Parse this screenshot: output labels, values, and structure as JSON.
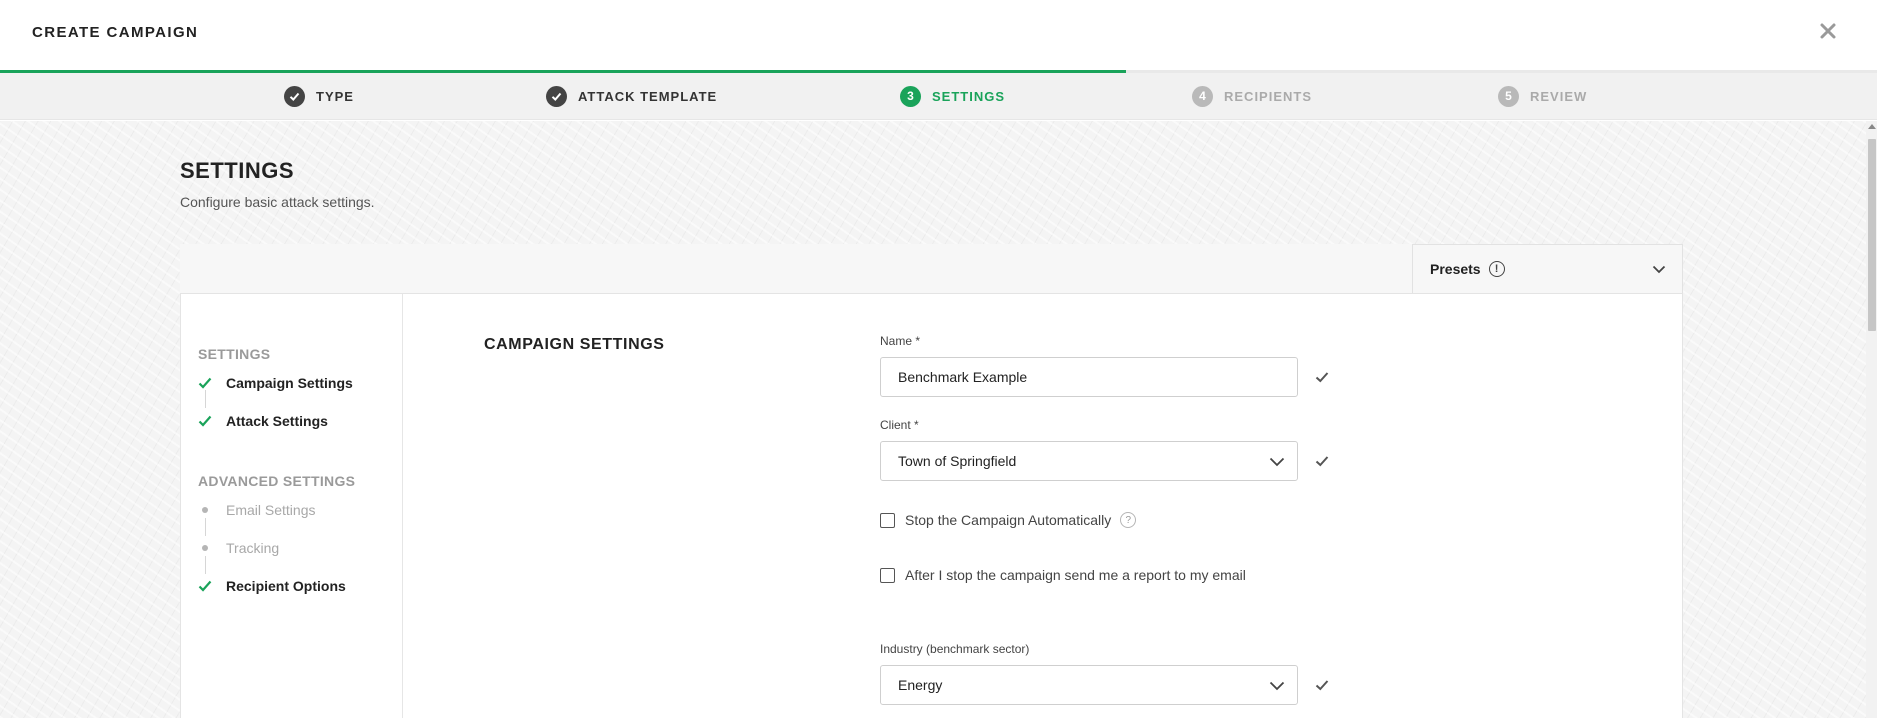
{
  "header": {
    "title": "CREATE CAMPAIGN",
    "close_icon": "close-icon"
  },
  "wizard": {
    "progress_percent": 60,
    "steps": [
      {
        "number": "1",
        "label": "TYPE",
        "state": "done"
      },
      {
        "number": "2",
        "label": "ATTACK TEMPLATE",
        "state": "done"
      },
      {
        "number": "3",
        "label": "SETTINGS",
        "state": "active"
      },
      {
        "number": "4",
        "label": "RECIPIENTS",
        "state": "todo"
      },
      {
        "number": "5",
        "label": "REVIEW",
        "state": "todo"
      }
    ]
  },
  "page": {
    "title": "SETTINGS",
    "subtitle": "Configure basic attack settings."
  },
  "presets": {
    "label": "Presets"
  },
  "sidenav": {
    "groups": [
      {
        "label": "SETTINGS",
        "items": [
          {
            "label": "Campaign Settings",
            "state": "complete"
          },
          {
            "label": "Attack Settings",
            "state": "complete"
          }
        ]
      },
      {
        "label": "ADVANCED SETTINGS",
        "items": [
          {
            "label": "Email Settings",
            "state": "pending"
          },
          {
            "label": "Tracking",
            "state": "pending"
          },
          {
            "label": "Recipient Options",
            "state": "complete"
          }
        ]
      }
    ]
  },
  "form": {
    "section_title": "CAMPAIGN SETTINGS",
    "name": {
      "label": "Name *",
      "value": "Benchmark Example"
    },
    "client": {
      "label": "Client *",
      "value": "Town of Springfield"
    },
    "stop_automatically": {
      "label": "Stop the Campaign Automatically",
      "checked": false
    },
    "send_report": {
      "label": "After I stop the campaign send me a report to my email",
      "checked": false
    },
    "industry": {
      "label": "Industry (benchmark sector)",
      "value": "Energy"
    }
  },
  "colors": {
    "accent_green": "#1aa35a",
    "done_badge": "#444444",
    "todo_badge": "#b9b9b9"
  }
}
